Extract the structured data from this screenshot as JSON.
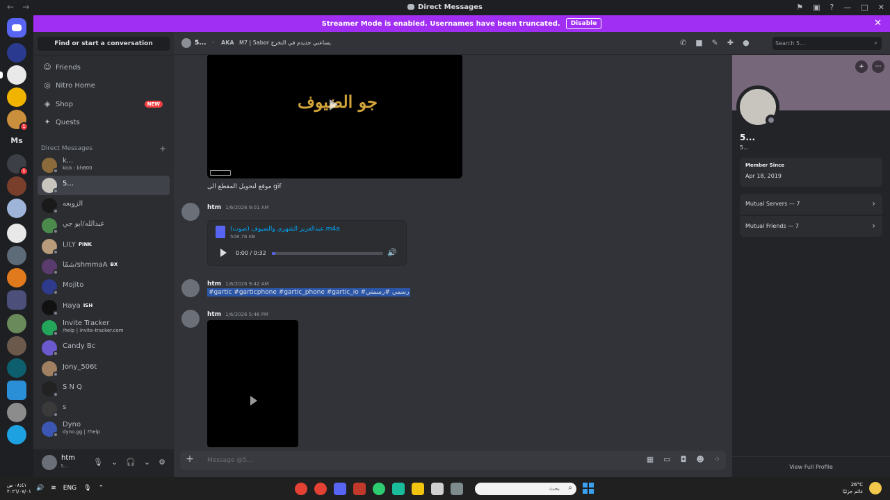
{
  "window": {
    "title": "Direct Messages"
  },
  "banner": {
    "text": "Streamer Mode is enabled. Usernames have been truncated.",
    "button": "Disable"
  },
  "servers": {
    "ms_label": "Ms",
    "badge": "1"
  },
  "sidebar": {
    "find_label": "Find or start a conversation",
    "nav": [
      {
        "label": "Friends",
        "icon": "friends-icon"
      },
      {
        "label": "Nitro Home",
        "icon": "nitro-icon"
      },
      {
        "label": "Shop",
        "icon": "shop-icon",
        "badge": "NEW"
      },
      {
        "label": "Quests",
        "icon": "quests-icon"
      }
    ],
    "dm_header": "Direct Messages",
    "dms": [
      {
        "name": "k...",
        "sub": "kick : kh600"
      },
      {
        "name": "5..."
      },
      {
        "name": "الزوبعه"
      },
      {
        "name": "عبدالله/ابو جي"
      },
      {
        "name": "LILY",
        "tag": "PINK"
      },
      {
        "name": "شمّا/shmmaA",
        "tag": "BX"
      },
      {
        "name": "Mojito"
      },
      {
        "name": "Haya",
        "tag": "ISH"
      },
      {
        "name": "Invite Tracker",
        "sub": "/help | invite-tracker.com"
      },
      {
        "name": "Candy Bc"
      },
      {
        "name": "Jony_506t"
      },
      {
        "name": "S N Q"
      },
      {
        "name": "s"
      },
      {
        "name": "Dyno",
        "sub": "dyno.gg | ?help"
      }
    ],
    "user": {
      "name": "htm",
      "status": "t..."
    }
  },
  "chat": {
    "header": {
      "name": "5...",
      "aka": "AKA",
      "aka_text": "M7 | 5abor يساعني جديدم في التخرج",
      "search_placeholder": "Search 5..."
    },
    "gif": {
      "overlay_text": "جو الضيوف",
      "caption": "موقع لتحويل المقطع الى gif"
    },
    "messages": [
      {
        "author": "htm",
        "time": "1/6/2026 9:01 AM"
      },
      {
        "author": "htm",
        "time": "1/6/2026 9:42 AM",
        "text": "#gartic #garticphone #gartic_phone #gartic_io #رسمي #رسمتي"
      },
      {
        "author": "htm",
        "time": "1/6/2026 5:46 PM"
      }
    ],
    "attachment": {
      "filename": "عبدالعزيز الشهري والضيوف (صوت).m4a",
      "size": "508.76 KB",
      "time": "0:00 / 0:32",
      "progress": 0.03
    },
    "composer_placeholder": "Message @5..."
  },
  "profile": {
    "name": "5...",
    "username": "5...",
    "member_since_label": "Member Since",
    "member_since": "Apr 18, 2019",
    "mutual_servers": "Mutual Servers — 7",
    "mutual_friends": "Mutual Friends — 7",
    "view_full": "View Full Profile"
  },
  "taskbar": {
    "time": "٠٨:٤١ ص",
    "date": "٢٠٢٦/٠٧/٠١",
    "lang": "ENG",
    "search_placeholder": "بحث",
    "temp": "26°C",
    "weather": "غائم جزئيًا"
  },
  "colors": {
    "accent": "#5865f2",
    "banner": "#a02ff3",
    "badge": "#f23f43"
  }
}
